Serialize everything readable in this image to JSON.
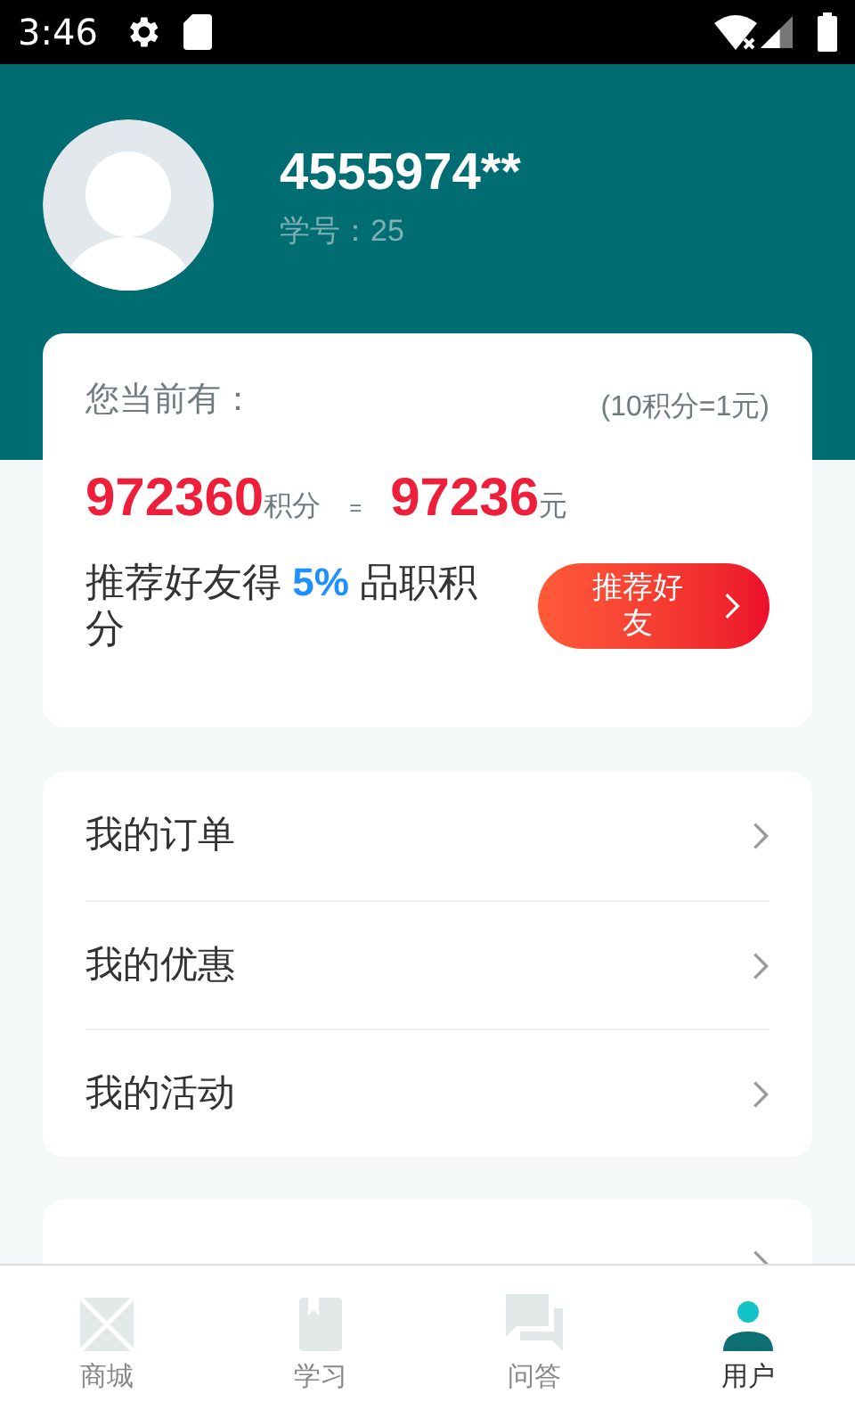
{
  "status_bar": {
    "time": "3:46"
  },
  "profile": {
    "name": "4555974**",
    "student_id": "学号：25"
  },
  "points_card": {
    "label": "您当前有：",
    "rate": "(10积分=1元)",
    "points": "972360",
    "points_unit": "积分",
    "equals": "=",
    "money": "97236",
    "money_unit": "元",
    "referral": "推荐好友得 **5%** 品职积分",
    "referral_button": "推荐好友"
  },
  "menu": [
    {
      "label": "我的订单"
    },
    {
      "label": "我的优惠"
    },
    {
      "label": "我的活动"
    }
  ],
  "tab_bar": [
    {
      "label": "商城",
      "selected": false
    },
    {
      "label": "学习",
      "selected": false
    },
    {
      "label": "问答",
      "selected": false
    },
    {
      "label": "用户",
      "selected": true
    }
  ]
}
